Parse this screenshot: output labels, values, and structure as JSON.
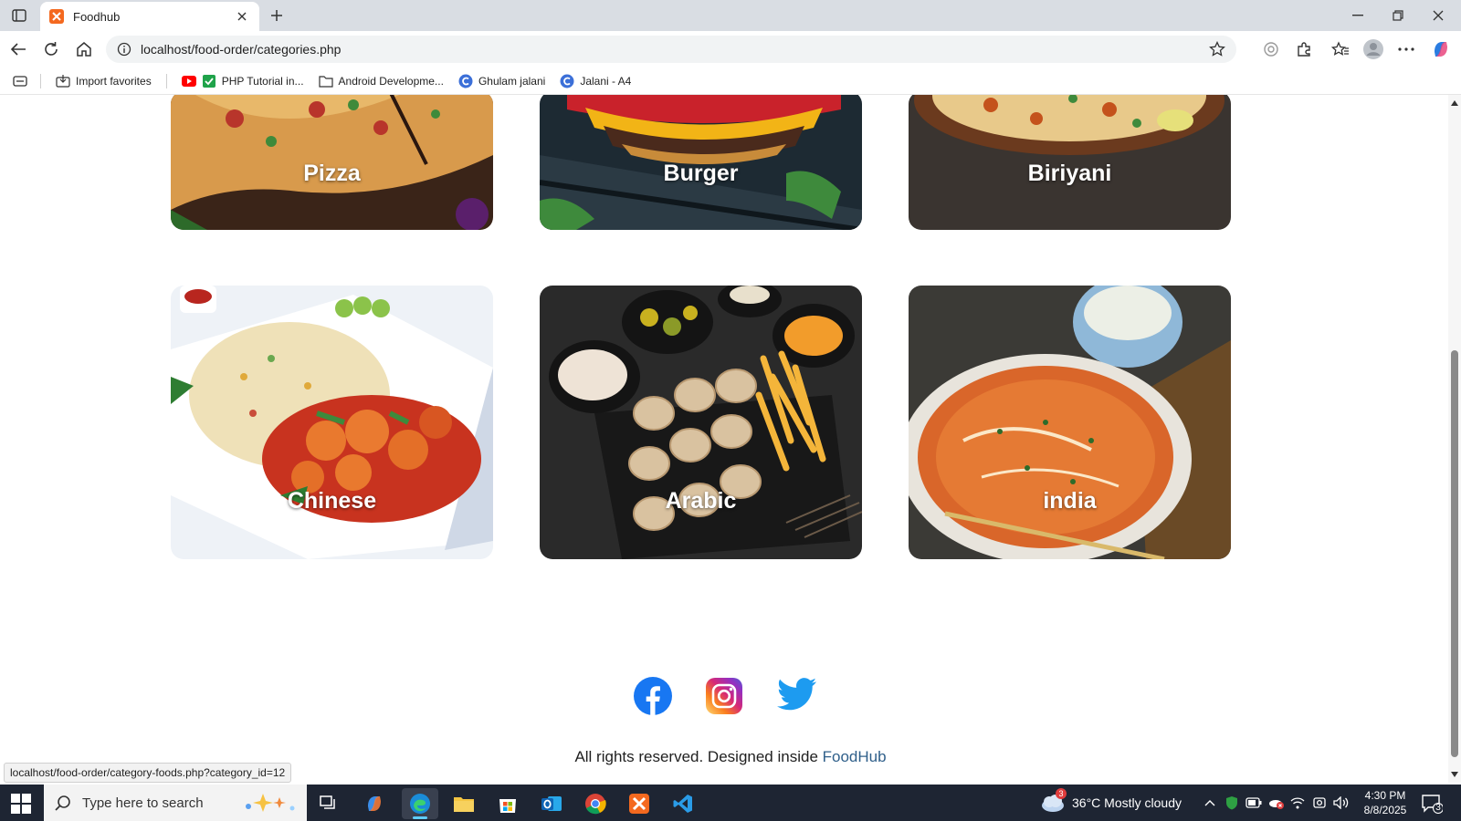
{
  "browser": {
    "tab_title": "Foodhub",
    "url": "localhost/food-order/categories.php",
    "bookmarks": [
      {
        "label": "Import favorites",
        "icon": "import-icon"
      },
      {
        "label": "PHP Tutorial in...",
        "icon": "youtube-icon"
      },
      {
        "label": "Android Developme...",
        "icon": "folder-icon"
      },
      {
        "label": "Ghulam jalani",
        "icon": "circle-c-icon"
      },
      {
        "label": "Jalani - A4",
        "icon": "circle-c-icon"
      }
    ]
  },
  "categories": [
    {
      "label": "Pizza"
    },
    {
      "label": "Burger"
    },
    {
      "label": "Biriyani"
    },
    {
      "label": "Chinese"
    },
    {
      "label": "Arabic"
    },
    {
      "label": "india"
    }
  ],
  "social": [
    {
      "icon": "facebook-icon"
    },
    {
      "icon": "instagram-icon"
    },
    {
      "icon": "twitter-icon"
    }
  ],
  "footer": {
    "text": "All rights reserved. Designed inside ",
    "brand": "FoodHub"
  },
  "status_bar": {
    "link_url": "localhost/food-order/category-foods.php?category_id=12"
  },
  "taskbar": {
    "search_placeholder": "Type here to search",
    "weather_badge": "3",
    "weather_text": "36°C  Mostly cloudy",
    "time": "4:30 PM",
    "date": "8/8/2025",
    "notifications": "3"
  },
  "colors": {
    "accent": "#f4691f",
    "brand_link": "#2f5f8a",
    "taskbar": "#1e2533"
  }
}
